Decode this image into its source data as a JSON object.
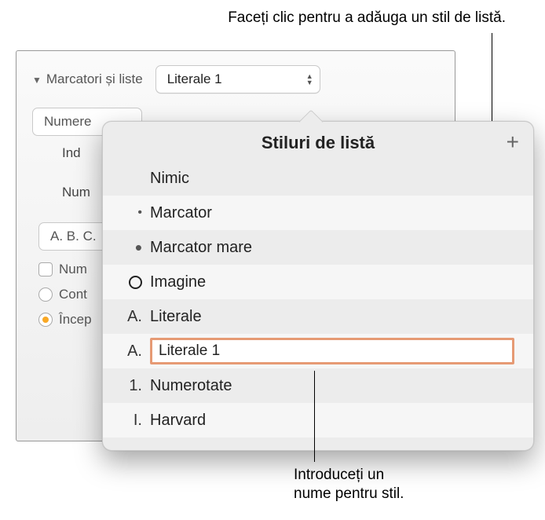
{
  "callouts": {
    "top": "Faceți clic pentru a adăuga un stil de listă.",
    "bottom_line1": "Introduceți un",
    "bottom_line2": "nume pentru stil."
  },
  "panel": {
    "section_label": "Marcatori și liste",
    "current_style": "Literale 1",
    "type_dropdown_value": "Numere",
    "indent_label": "Ind",
    "numbering_label": "Num",
    "format_example": "A. B. C.",
    "checkbox_label": "Num",
    "radio1_label": "Cont",
    "radio2_label": "Încep"
  },
  "popover": {
    "title": "Stiluri de listă",
    "add_button": "+",
    "items": [
      {
        "marker": "",
        "label": "Nimic"
      },
      {
        "marker": "dot-sm",
        "label": "Marcator"
      },
      {
        "marker": "dot-lg",
        "label": "Marcator mare"
      },
      {
        "marker": "ring",
        "label": "Imagine"
      },
      {
        "marker": "A.",
        "label": "Literale"
      },
      {
        "marker": "A.",
        "label": "Literale 1",
        "editing": true
      },
      {
        "marker": "1.",
        "label": "Numerotate"
      },
      {
        "marker": "I.",
        "label": "Harvard"
      }
    ]
  }
}
